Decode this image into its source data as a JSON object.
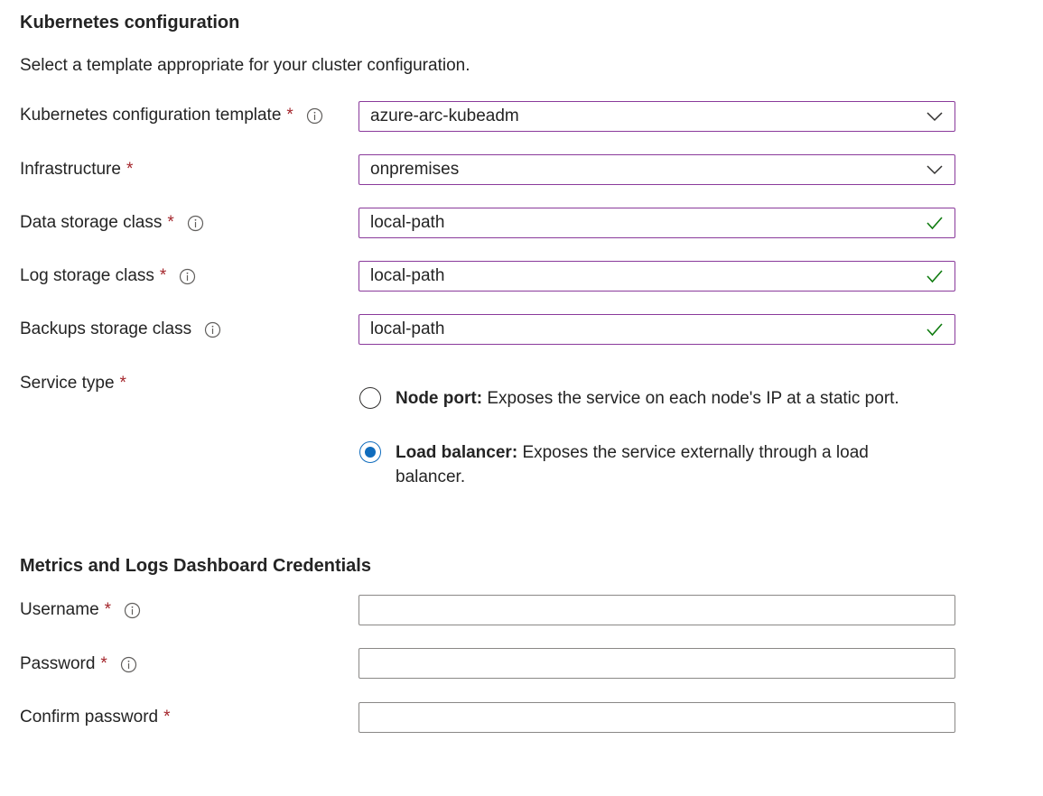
{
  "kubernetes_section": {
    "title": "Kubernetes configuration",
    "description": "Select a template appropriate for your cluster configuration."
  },
  "fields": {
    "template": {
      "label": "Kubernetes configuration template",
      "required_mark": "*",
      "value": "azure-arc-kubeadm"
    },
    "infrastructure": {
      "label": "Infrastructure",
      "required_mark": "*",
      "value": "onpremises"
    },
    "data_storage": {
      "label": "Data storage class",
      "required_mark": "*",
      "value": "local-path"
    },
    "log_storage": {
      "label": "Log storage class",
      "required_mark": "*",
      "value": "local-path"
    },
    "backups_storage": {
      "label": "Backups storage class",
      "value": "local-path"
    }
  },
  "service_type": {
    "label": "Service type",
    "required_mark": "*",
    "options": [
      {
        "title": "Node port:",
        "description": "Exposes the service on each node's IP at a static port.",
        "selected": false
      },
      {
        "title": "Load balancer:",
        "description": "Exposes the service externally through a load",
        "description_line2": "balancer.",
        "selected": true
      }
    ]
  },
  "credentials_section": {
    "title": "Metrics and Logs Dashboard Credentials",
    "username": {
      "label": "Username",
      "required_mark": "*",
      "value": ""
    },
    "password": {
      "label": "Password",
      "required_mark": "*",
      "value": ""
    },
    "confirm_password": {
      "label": "Confirm password",
      "required_mark": "*",
      "value": ""
    }
  },
  "colors": {
    "focus_border": "#8a3a9b",
    "required": "#a4262c",
    "valid_check": "#107c10",
    "radio_selected": "#0f6cbd"
  },
  "icons": [
    "info-icon",
    "chevron-down-icon",
    "checkmark-icon"
  ]
}
